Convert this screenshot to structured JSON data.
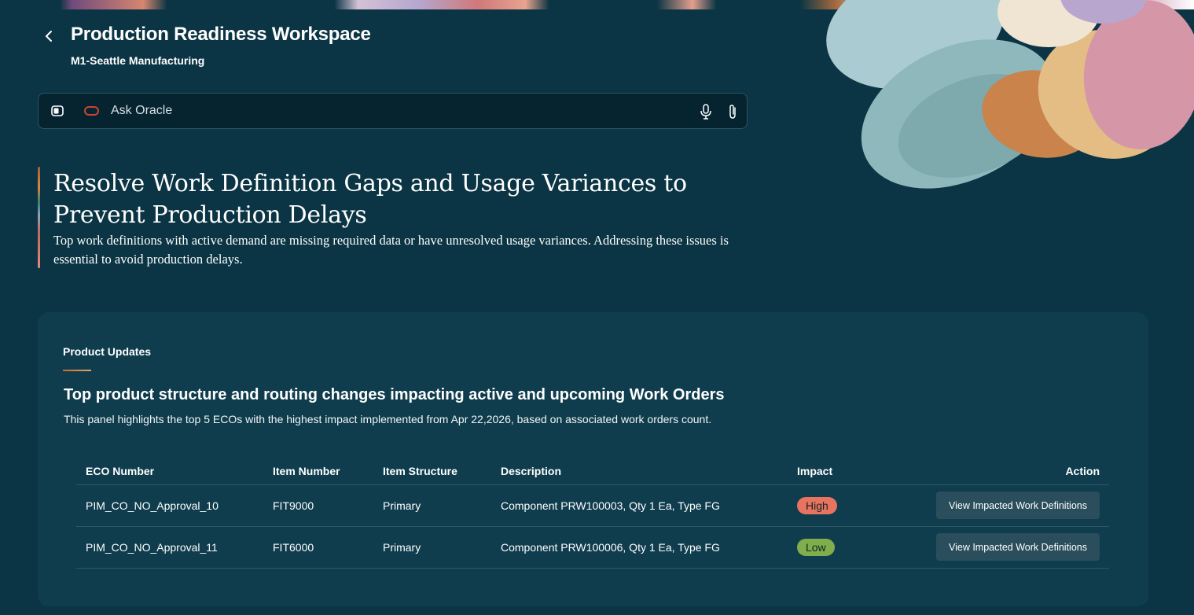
{
  "header": {
    "title": "Production Readiness Workspace",
    "subtitle": "M1-Seattle Manufacturing"
  },
  "ask_bar": {
    "placeholder": "Ask Oracle"
  },
  "headline": {
    "title": "Resolve Work Definition Gaps and Usage Variances to Prevent Production Delays",
    "description": "Top work definitions with active demand are missing required data or have unresolved usage variances. Addressing these issues is essential to avoid production delays."
  },
  "card": {
    "eyebrow": "Product Updates",
    "title": "Top product structure and routing changes impacting active and upcoming Work Orders",
    "description": "This panel highlights the top 5 ECOs with the highest impact implemented from Apr 22,2026, based on associated work orders count.",
    "columns": [
      "ECO Number",
      "Item Number",
      "Item Structure",
      "Description",
      "Impact",
      "Action"
    ],
    "rows": [
      {
        "eco": "PIM_CO_NO_Approval_10",
        "item": "FIT9000",
        "structure": "Primary",
        "description": "Component PRW100003, Qty 1 Ea, Type FG",
        "impact": "High",
        "impact_color": "#e8735f",
        "action": "View Impacted Work Definitions"
      },
      {
        "eco": "PIM_CO_NO_Approval_11",
        "item": "FIT6000",
        "structure": "Primary",
        "description": "Component PRW100006, Qty 1 Ea, Type FG",
        "impact": "Low",
        "impact_color": "#7fae4a",
        "action": "View Impacted Work Definitions"
      }
    ]
  },
  "colors": {
    "background": "#0b3544",
    "card": "#0f3d4e",
    "oracle_red": "#c74634",
    "button": "#2a4e5c"
  }
}
